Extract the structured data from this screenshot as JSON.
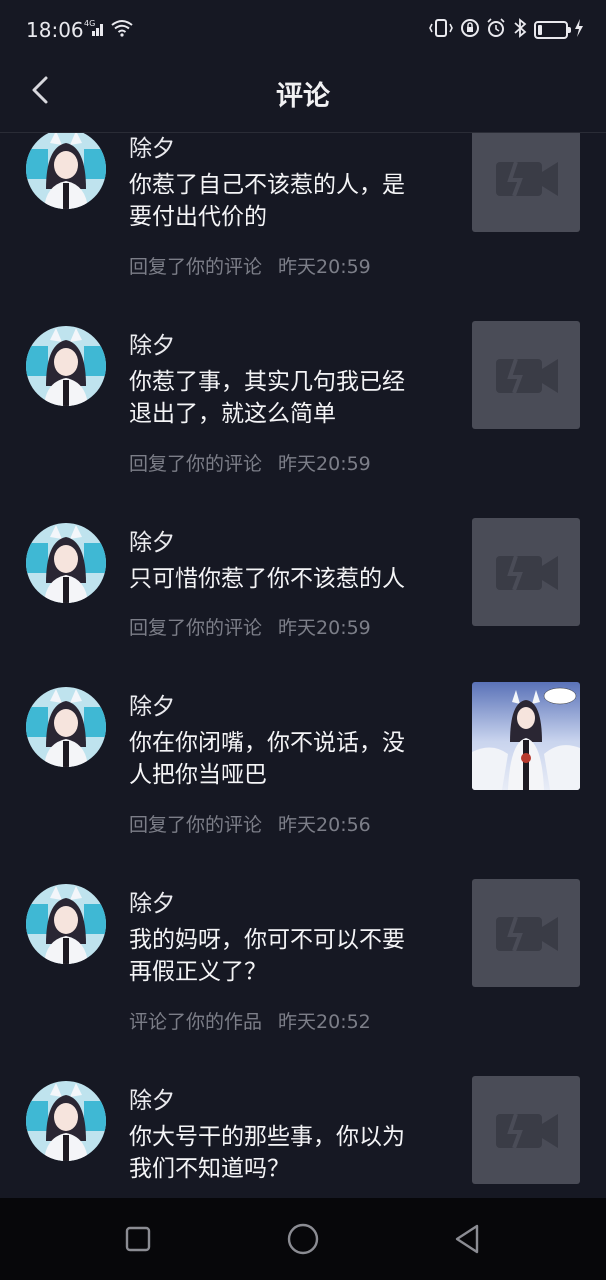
{
  "status_bar": {
    "time": "18:06",
    "network": "4G",
    "icons": [
      "signal-icon",
      "wifi-icon",
      "vibrate-icon",
      "data-saver-icon",
      "alarm-icon",
      "bluetooth-icon",
      "battery-icon",
      "charging-icon"
    ]
  },
  "nav": {
    "title": "评论",
    "back_icon": "chevron-left-icon"
  },
  "notifications": [
    {
      "username": "除夕",
      "comment_line1": "你惹了自己不该惹的人，是",
      "comment_line2": "要付出代价的",
      "action": "回复了你的评论",
      "time": "昨天20:59",
      "thumbnail": "placeholder"
    },
    {
      "username": "除夕",
      "comment_line1": "你惹了事，其实几句我已经",
      "comment_line2": "退出了，就这么简单",
      "action": "回复了你的评论",
      "time": "昨天20:59",
      "thumbnail": "placeholder"
    },
    {
      "username": "除夕",
      "comment_line1": "只可惜你惹了你不该惹的人",
      "comment_line2": "",
      "action": "回复了你的评论",
      "time": "昨天20:59",
      "thumbnail": "placeholder"
    },
    {
      "username": "除夕",
      "comment_line1": "你在你闭嘴，你不说话，没",
      "comment_line2": "人把你当哑巴",
      "action": "回复了你的评论",
      "time": "昨天20:56",
      "thumbnail": "image"
    },
    {
      "username": "除夕",
      "comment_line1": "我的妈呀，你可不可以不要",
      "comment_line2": "再假正义了？",
      "action": "评论了你的作品",
      "time": "昨天20:52",
      "thumbnail": "placeholder"
    },
    {
      "username": "除夕",
      "comment_line1": "你大号干的那些事，你以为",
      "comment_line2": "我们不知道吗？",
      "action": "",
      "time": "",
      "thumbnail": "placeholder"
    }
  ],
  "system_nav": {
    "icons": [
      "recent-apps-icon",
      "home-icon",
      "back-triangle-icon"
    ]
  },
  "colors": {
    "background": "#161823",
    "text_primary": "#f4f4f6",
    "text_secondary": "#7c7e88",
    "placeholder": "#4a4c57",
    "system_nav_bg": "#07070a"
  }
}
